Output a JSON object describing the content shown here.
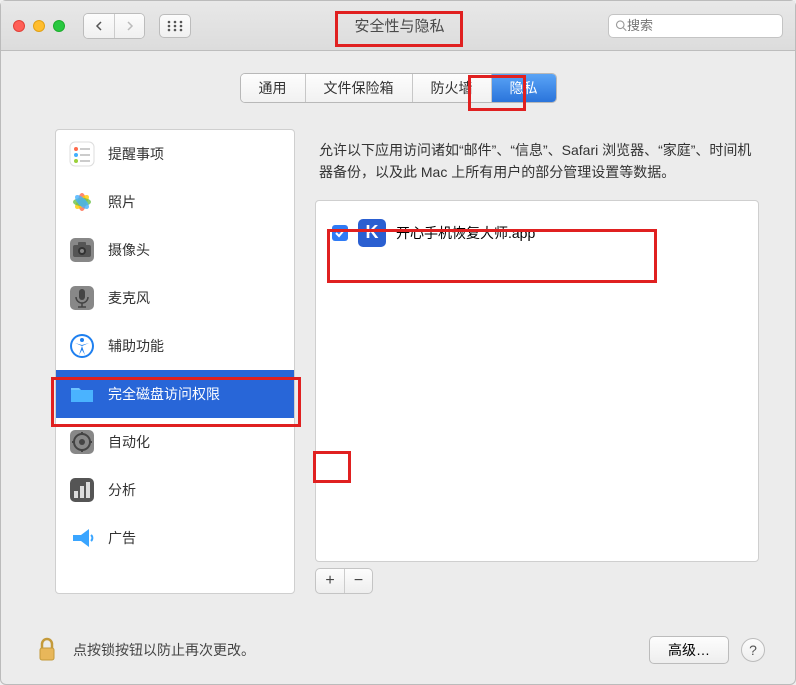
{
  "window": {
    "title": "安全性与隐私"
  },
  "search": {
    "placeholder": "搜索"
  },
  "tabs": {
    "general": "通用",
    "filevault": "文件保险箱",
    "firewall": "防火墙",
    "privacy": "隐私"
  },
  "sidebar": {
    "items": [
      {
        "label": "提醒事项"
      },
      {
        "label": "照片"
      },
      {
        "label": "摄像头"
      },
      {
        "label": "麦克风"
      },
      {
        "label": "辅助功能"
      },
      {
        "label": "完全磁盘访问权限"
      },
      {
        "label": "自动化"
      },
      {
        "label": "分析"
      },
      {
        "label": "广告"
      }
    ]
  },
  "description": "允许以下应用访问诸如“邮件”、“信息”、Safari 浏览器、“家庭”、时间机器备份，以及此 Mac 上所有用户的部分管理设置等数据。",
  "apps": [
    {
      "name": "开心手机恢复大师.app",
      "checked": true,
      "icon_letter": "K"
    }
  ],
  "buttons": {
    "add": "+",
    "remove": "−",
    "advanced": "高级…",
    "help": "?"
  },
  "footer": {
    "lock_text": "点按锁按钮以防止再次更改。"
  }
}
